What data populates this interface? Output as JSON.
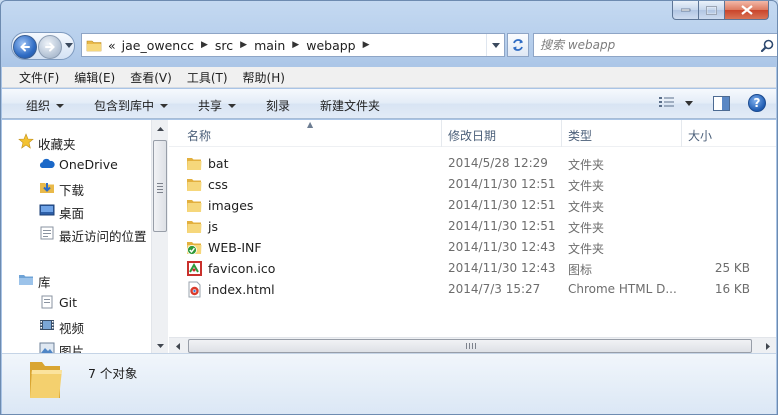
{
  "window": {
    "caption_buttons": [
      "minimize",
      "maximize",
      "close"
    ]
  },
  "address_bar": {
    "overflow": "«",
    "crumbs": [
      "jae_owencc",
      "src",
      "main",
      "webapp"
    ]
  },
  "search": {
    "placeholder": "搜索 webapp"
  },
  "menu": {
    "items": [
      "文件(F)",
      "编辑(E)",
      "查看(V)",
      "工具(T)",
      "帮助(H)"
    ]
  },
  "commands": {
    "organize": "组织",
    "include_library": "包含到库中",
    "share": "共享",
    "burn": "刻录",
    "new_folder": "新建文件夹"
  },
  "nav": {
    "favorites": "收藏夹",
    "onedrive": "OneDrive",
    "downloads": "下载",
    "desktop": "桌面",
    "recent": "最近访问的位置",
    "libraries": "库",
    "git": "Git",
    "videos": "视频",
    "pictures": "图片"
  },
  "columns": {
    "name": "名称",
    "date": "修改日期",
    "type": "类型",
    "size": "大小"
  },
  "files": [
    {
      "name": "bat",
      "date": "2014/5/28 12:29",
      "type": "文件夹",
      "size": "",
      "icon": "folder-icon"
    },
    {
      "name": "css",
      "date": "2014/11/30 12:51",
      "type": "文件夹",
      "size": "",
      "icon": "folder-icon"
    },
    {
      "name": "images",
      "date": "2014/11/30 12:51",
      "type": "文件夹",
      "size": "",
      "icon": "folder-icon"
    },
    {
      "name": "js",
      "date": "2014/11/30 12:51",
      "type": "文件夹",
      "size": "",
      "icon": "folder-icon"
    },
    {
      "name": "WEB-INF",
      "date": "2014/11/30 12:43",
      "type": "文件夹",
      "size": "",
      "icon": "git-folder-icon"
    },
    {
      "name": "favicon.ico",
      "date": "2014/11/30 12:43",
      "type": "图标",
      "size": "25 KB",
      "icon": "favicon-icon"
    },
    {
      "name": "index.html",
      "date": "2014/7/3 15:27",
      "type": "Chrome HTML D...",
      "size": "16 KB",
      "icon": "chrome-html-icon"
    }
  ],
  "details": {
    "count_text": "7 个对象"
  },
  "colors": {
    "accent": "#2f6cc4",
    "folder": "#f2cf6b",
    "text_muted": "#6d6d6d"
  }
}
